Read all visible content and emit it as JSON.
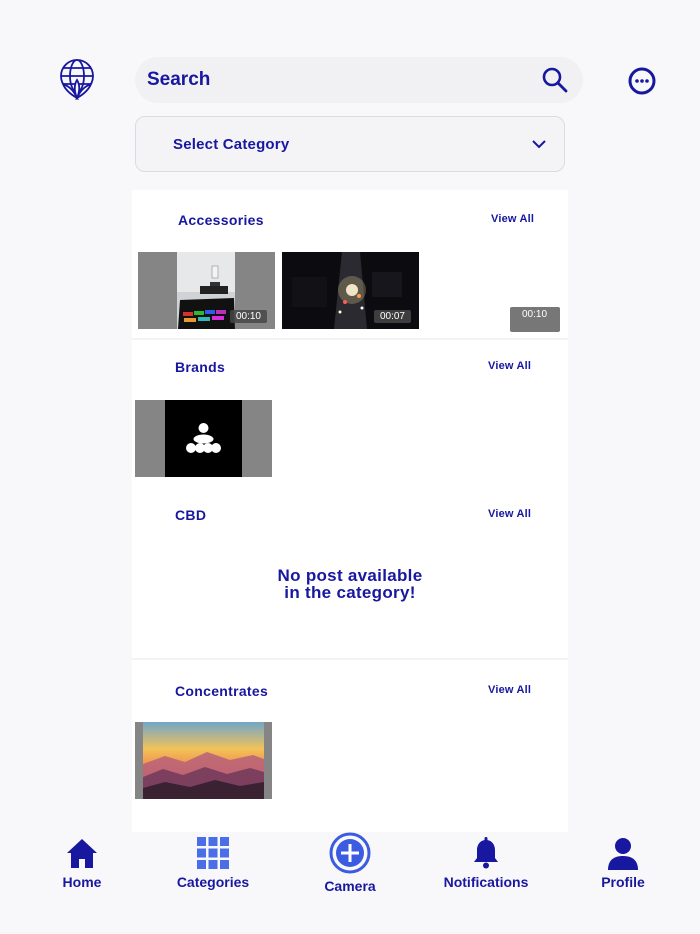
{
  "header": {
    "search_placeholder": "Search",
    "category_placeholder": "Select Category"
  },
  "sections": [
    {
      "title": "Accessories",
      "view_all": "View All",
      "thumbs": [
        {
          "duration": "00:10"
        },
        {
          "duration": "00:07"
        },
        {
          "duration": "00:10"
        }
      ]
    },
    {
      "title": "Brands",
      "view_all": "View All"
    },
    {
      "title": "CBD",
      "view_all": "View All",
      "empty_line1": "No post available",
      "empty_line2": "in the category!"
    },
    {
      "title": "Concentrates",
      "view_all": "View All"
    }
  ],
  "tabs": [
    {
      "label": "Home",
      "icon": "home-icon"
    },
    {
      "label": "Categories",
      "icon": "grid-icon"
    },
    {
      "label": "Camera",
      "icon": "plus-circle-icon"
    },
    {
      "label": "Notifications",
      "icon": "bell-icon"
    },
    {
      "label": "Profile",
      "icon": "user-icon"
    }
  ],
  "colors": {
    "accent": "#1717a0",
    "background": "#f8f8fa",
    "card": "#ffffff"
  }
}
